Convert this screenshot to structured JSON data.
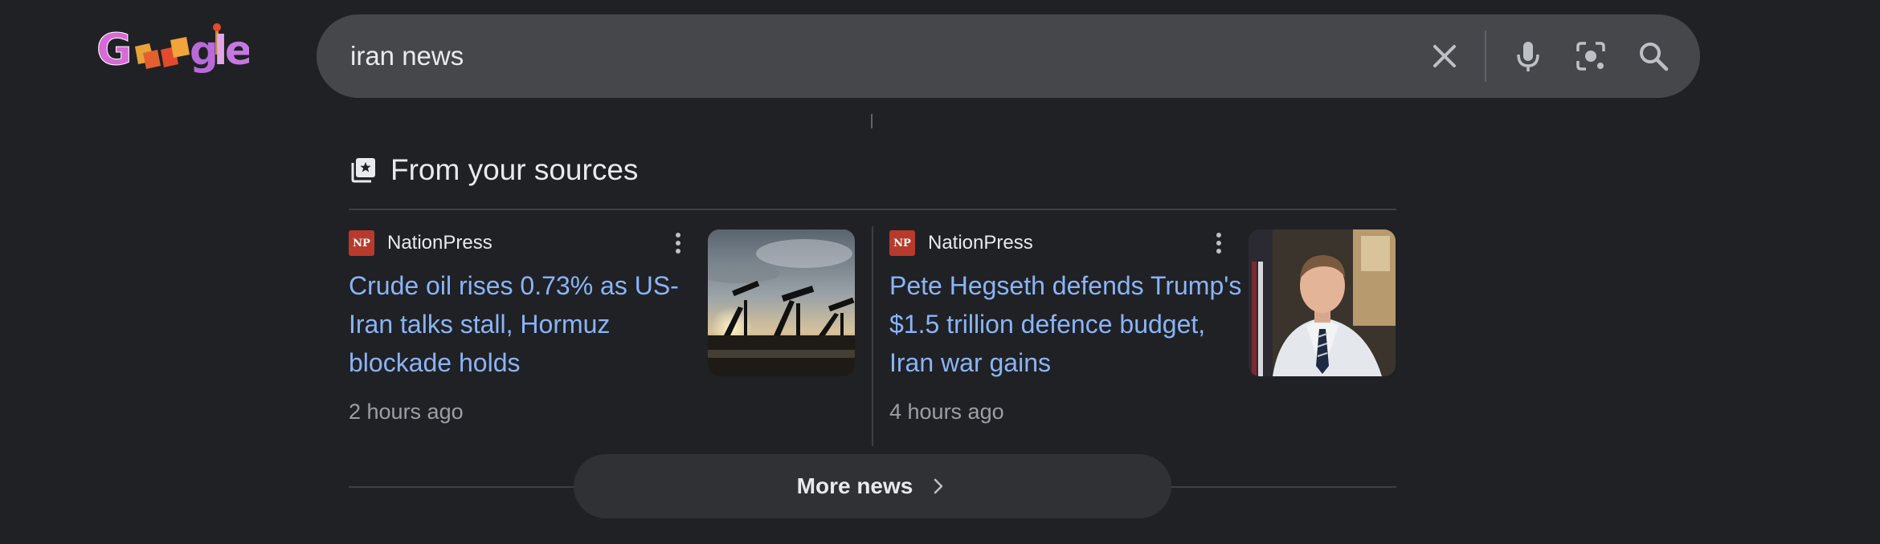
{
  "logo": {
    "alt": "Google"
  },
  "search": {
    "query": "iran news",
    "icons": [
      "close-icon",
      "microphone-icon",
      "camera-lens-icon",
      "search-icon"
    ]
  },
  "section": {
    "title": "From your sources",
    "icon": "sources-icon"
  },
  "articles": [
    {
      "source_logo": "NP",
      "source": "NationPress",
      "headline": "Crude oil rises 0.73% as US-Iran talks stall, Hormuz blockade holds",
      "time": "2 hours ago",
      "thumbnail": "oil-pumpjacks-sunset-image"
    },
    {
      "source_logo": "NP",
      "source": "NationPress",
      "headline": "Pete Hegseth defends Trump's $1.5 trillion defence budget, Iran war gains",
      "time": "4 hours ago",
      "thumbnail": "man-in-suit-image"
    }
  ],
  "more_news": {
    "label": "More news"
  },
  "colors": {
    "background": "#202124",
    "searchbar": "#45474b",
    "link": "#8ab4f8",
    "muted": "#9aa0a6",
    "source_logo": "#b83a2c"
  }
}
